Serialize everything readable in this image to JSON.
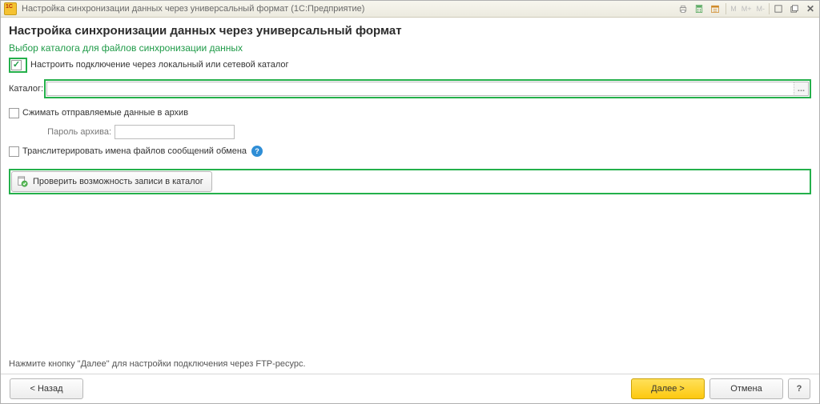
{
  "titlebar": {
    "title": "Настройка синхронизации данных через универсальный формат  (1С:Предприятие)",
    "m": "M",
    "mplus": "M+",
    "mminus": "M-"
  },
  "heading": "Настройка синхронизации данных через универсальный формат",
  "subheading": "Выбор каталога для файлов синхронизации данных",
  "options": {
    "localConnect": {
      "label": "Настроить подключение через локальный или сетевой каталог",
      "checked": true
    },
    "catalogLabel": "Каталог:",
    "catalogValue": "",
    "browseLabel": "...",
    "compress": {
      "label": "Сжимать отправляемые данные в архив",
      "checked": false
    },
    "passwordLabel": "Пароль архива:",
    "passwordValue": "",
    "translit": {
      "label": "Транслитерировать имена файлов сообщений обмена",
      "checked": false
    },
    "testWriteLabel": "Проверить возможность записи в каталог"
  },
  "hint": "Нажмите кнопку \"Далее\" для настройки подключения через FTP-ресурс.",
  "footer": {
    "back": "< Назад",
    "next": "Далее >",
    "cancel": "Отмена",
    "help": "?"
  }
}
